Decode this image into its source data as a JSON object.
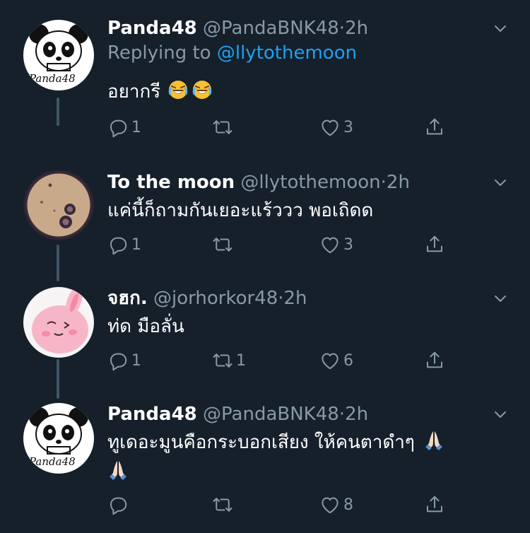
{
  "colors": {
    "background": "#15202b",
    "secondary_text": "#8899a6",
    "link": "#1da1f2",
    "thread_line": "#3d5466"
  },
  "tweets": [
    {
      "display_name": "Panda48",
      "handle": "@PandaBNK48",
      "separator": "·",
      "time": "2h",
      "reply_prefix": "Replying to ",
      "reply_handle": "@llytothemoon",
      "text": "อยากรี",
      "emoji": [
        "face-with-tears-of-joy",
        "face-with-tears-of-joy"
      ],
      "avatar_text": "Panda48",
      "replies": "1",
      "retweets": "",
      "likes": "3"
    },
    {
      "display_name": "To the moon",
      "handle": "@llytothemoon",
      "separator": "·",
      "time": "2h",
      "text": "แค่นี้ก็ถามกันเยอะแร้ววว พอเถิดด",
      "replies": "1",
      "retweets": "",
      "likes": "3"
    },
    {
      "display_name": "จฮก.",
      "handle": "@jorhorkor48",
      "separator": "·",
      "time": "2h",
      "text": "ท่ด มือลั่น",
      "replies": "1",
      "retweets": "1",
      "likes": "6"
    },
    {
      "display_name": "Panda48",
      "handle": "@PandaBNK48",
      "separator": "·",
      "time": "2h",
      "text": "ทูเดอะมูนคือกระบอกเสียง ให้คนตาดำๆ",
      "emoji": [
        "folded-hands",
        "folded-hands"
      ],
      "avatar_text": "Panda48",
      "replies": "",
      "retweets": "",
      "likes": "8"
    }
  ]
}
